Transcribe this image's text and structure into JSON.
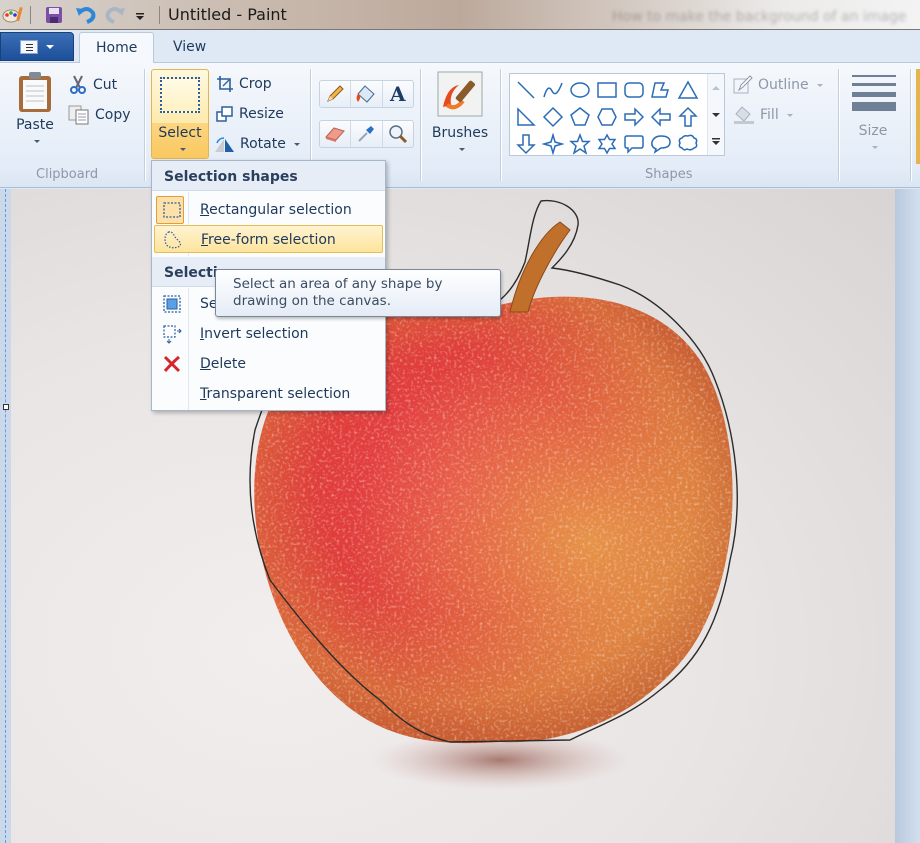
{
  "window": {
    "title": "Untitled - Paint",
    "background_title_ghost": "How to make the background of an image"
  },
  "quick_access": {
    "icons": [
      "paint-app-icon",
      "save-icon",
      "undo-icon",
      "redo-icon",
      "customize-dropdown-icon"
    ]
  },
  "tabs": [
    {
      "label": "Home",
      "active": true
    },
    {
      "label": "View",
      "active": false
    }
  ],
  "ribbon": {
    "clipboard": {
      "group_label": "Clipboard",
      "paste": "Paste",
      "cut": "Cut",
      "copy": "Copy"
    },
    "image": {
      "select": "Select",
      "crop": "Crop",
      "resize": "Resize",
      "rotate": "Rotate"
    },
    "tools": {
      "items": [
        "pencil",
        "fill-bucket",
        "text",
        "eraser",
        "color-picker",
        "magnifier"
      ]
    },
    "brushes": {
      "label": "Brushes"
    },
    "shapes": {
      "group_label": "Shapes",
      "items": [
        "line",
        "curve",
        "oval",
        "rectangle",
        "rounded-rectangle",
        "polygon",
        "triangle",
        "right-triangle",
        "diamond",
        "pentagon",
        "hexagon",
        "right-arrow",
        "left-arrow",
        "up-arrow",
        "down-arrow",
        "four-point-star",
        "five-point-star",
        "six-point-star",
        "rounded-callout",
        "oval-callout",
        "cloud-callout"
      ],
      "outline": "Outline",
      "fill": "Fill"
    },
    "size": {
      "label": "Size"
    }
  },
  "select_menu": {
    "section1": "Selection shapes",
    "items1": [
      {
        "accel": "R",
        "rest": "ectangular selection",
        "checked": true
      },
      {
        "accel": "F",
        "rest": "ree-form selection",
        "hover": true
      }
    ],
    "section2": "Selection options",
    "items2": [
      {
        "accel": "",
        "rest": "Select all"
      },
      {
        "accel": "I",
        "rest": "nvert selection"
      },
      {
        "accel": "D",
        "rest": "elete"
      },
      {
        "accel": "T",
        "rest": "ransparent selection"
      }
    ],
    "section2_visible": "Selectio",
    "item_select_all_visible": "Se"
  },
  "tooltip": {
    "line1": "Select an area of any shape by",
    "line2": "drawing on the canvas."
  },
  "colors": {
    "accent_hover": "#fde49c",
    "ribbon_bg": "#e3ecf7",
    "text": "#1e395b",
    "selection_dash": "#5a9ee8"
  }
}
